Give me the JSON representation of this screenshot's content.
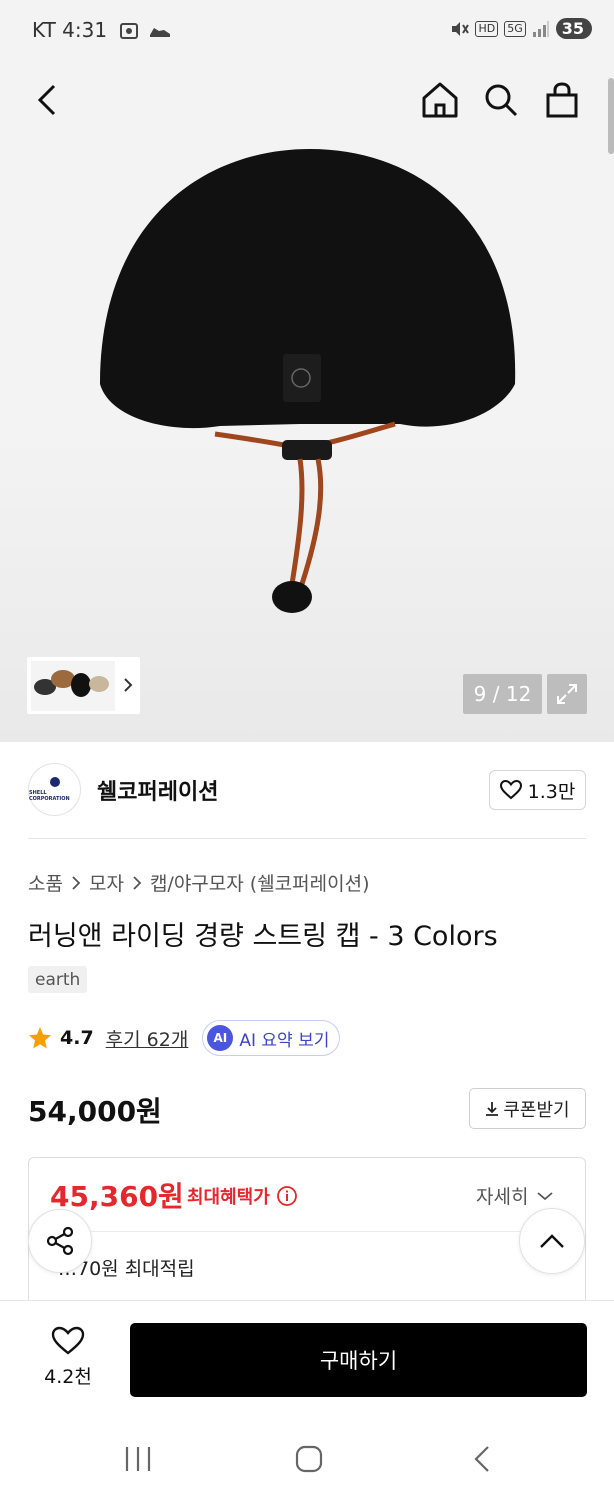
{
  "status_bar": {
    "carrier_time": "KT 4:31",
    "hd": "HD",
    "network": "5G",
    "battery": "35"
  },
  "gallery": {
    "counter": "9 / 12"
  },
  "brand": {
    "name": "쉘코퍼레이션",
    "logo_text": "SHELL CORPORATION",
    "likes": "1.3만"
  },
  "breadcrumb": [
    "소품",
    "모자",
    "캡/야구모자 (쉘코퍼레이션)"
  ],
  "product": {
    "title": "러닝앤 라이딩 경량 스트링 캡 - 3 Colors",
    "tag": "earth",
    "rating": "4.7",
    "reviews": "후기 62개",
    "ai_badge": "AI",
    "ai_summary": "AI 요약 보기",
    "price": "54,000원",
    "coupon": "쿠폰받기"
  },
  "benefit": {
    "sale_price": "45,360원",
    "sale_label": "최대혜택가",
    "detail": "자세히",
    "points": "…70원 최대적립"
  },
  "bottom": {
    "wish_count": "4.2천",
    "buy": "구매하기"
  },
  "colors": {
    "sale": "#e5282b",
    "ai": "#4b56e0",
    "buy_bg": "#000000"
  }
}
